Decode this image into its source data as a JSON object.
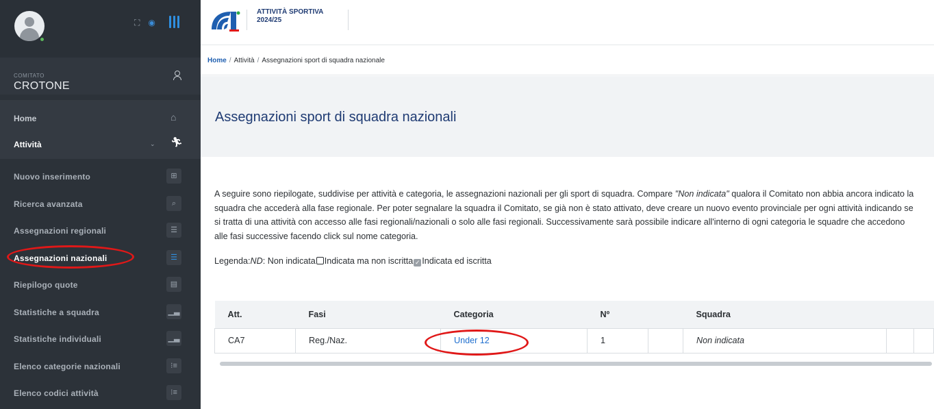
{
  "sidebar": {
    "comitato_label": "COMITATO",
    "comitato_name": "CROTONE",
    "main_nav": [
      {
        "label": "Home",
        "icon": "home-icon"
      },
      {
        "label": "Attività",
        "icon": "runner-icon"
      }
    ],
    "sub_nav": [
      {
        "label": "Nuovo inserimento",
        "icon": "plus-square-icon"
      },
      {
        "label": "Ricerca avanzata",
        "icon": "search-icon"
      },
      {
        "label": "Assegnazioni regionali",
        "icon": "list-icon"
      },
      {
        "label": "Assegnazioni nazionali",
        "icon": "list-icon",
        "active": true
      },
      {
        "label": "Riepilogo quote",
        "icon": "card-icon"
      },
      {
        "label": "Statistiche a squadra",
        "icon": "chart-icon"
      },
      {
        "label": "Statistiche individuali",
        "icon": "chart-icon"
      },
      {
        "label": "Elenco categorie nazionali",
        "icon": "numbered-list-icon"
      },
      {
        "label": "Elenco codici attività",
        "icon": "numbered-list-icon"
      }
    ]
  },
  "header": {
    "app_title_line1": "ATTIVITÀ SPORTIVA",
    "app_title_line2": "2024/25"
  },
  "breadcrumb": [
    "Home",
    "Attività",
    "Assegnazioni sport di squadra nazionale"
  ],
  "page_title": "Assegnazioni sport di squadra nazionali",
  "intro": {
    "part1": "A seguire sono riepilogate, suddivise per attività e categoria, le assegnazioni nazionali per gli sport di squadra. Compare ",
    "emphasis": "\"Non indicata\"",
    "part2": " qualora il Comitato non abbia ancora indicato la squadra che accederà alla fase regionale. Per poter segnalare la squadra il Comitato, se già non è stato attivato, deve creare un nuovo evento provinciale per ogni attività indicando se si tratta di una attività con accesso alle fasi regionali/nazionali o solo alle fasi regionali. Successivamente sarà possibile indicare all'interno di ogni categoria le squadre che accedono alle fasi successive facendo click sul nome categoria."
  },
  "legend": {
    "prefix": "Legenda:",
    "nd": "ND",
    "nd_text": ": Non indicata",
    "empty_text": "Indicata ma non iscritta",
    "checked_text": "Indicata ed iscritta"
  },
  "table": {
    "headers": [
      "Att.",
      "Fasi",
      "Categoria",
      "Nº",
      "Squadra"
    ],
    "rows": [
      {
        "att": "CA7",
        "fasi": "Reg./Naz.",
        "categoria": "Under 12",
        "numero": "1",
        "squadra": "Non indicata"
      }
    ]
  },
  "colors": {
    "sidebar_bg": "#2c3239",
    "accent_blue": "#2f8fe0",
    "title_blue": "#1f3b73",
    "link_blue": "#1f6fcf",
    "highlight_red": "#e01818"
  }
}
